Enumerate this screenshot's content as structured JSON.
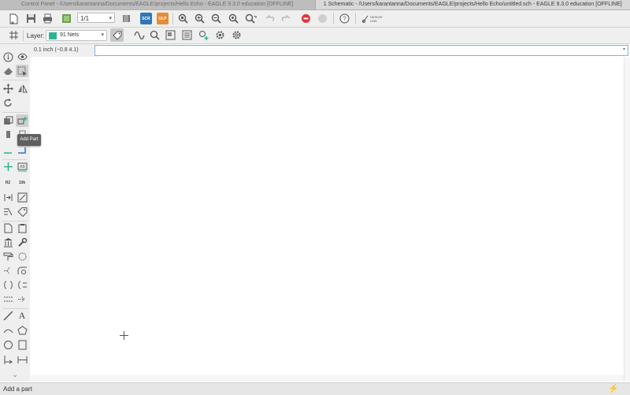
{
  "window_tabs": [
    {
      "label": "Control Panel - /Users/karantanna/Documents/EAGLE/projects/Hello Echo - EAGLE 9.3.0 education [OFFLINE]",
      "active": false
    },
    {
      "label": "1 Schematic - /Users/karantanna/Documents/EAGLE/projects/Hello Echo/untitled.sch - EAGLE 9.3.0 education [OFFLINE]",
      "active": true
    }
  ],
  "toolbar": {
    "page_selector": {
      "value": "1/1"
    },
    "scr_badge": "SCR",
    "ulp_badge": "ULP",
    "design_link": "DESIGN LINK",
    "icons": [
      "open-icon",
      "save-icon",
      "print-icon",
      "cam-icon",
      "page-selector",
      "book-icon",
      "scr-button",
      "ulp-button",
      "zoom-to-fit-icon",
      "zoom-in-icon",
      "zoom-out-icon",
      "zoom-redraw-icon",
      "zoom-select-icon",
      "undo-icon",
      "redo-icon",
      "stop-icon",
      "go-icon",
      "help-icon",
      "design-link-icon"
    ]
  },
  "layer_toolbar": {
    "grid_icon": "grid-icon",
    "layer_label": "Layer:",
    "layer_value": "91 Nets",
    "layer_color": "#2bb494"
  },
  "coordinates": {
    "text": "0.1 inch (−0.8 4.1)"
  },
  "command_line": {
    "value": ""
  },
  "tooltip": {
    "text": "Add Part"
  },
  "status": {
    "text": "Add a part"
  },
  "colors": {
    "accent": "#79b7d1",
    "stop": "#e0343a",
    "scr": "#2f76bb",
    "ulp": "#e98a35",
    "bolt": "#f2b134"
  }
}
